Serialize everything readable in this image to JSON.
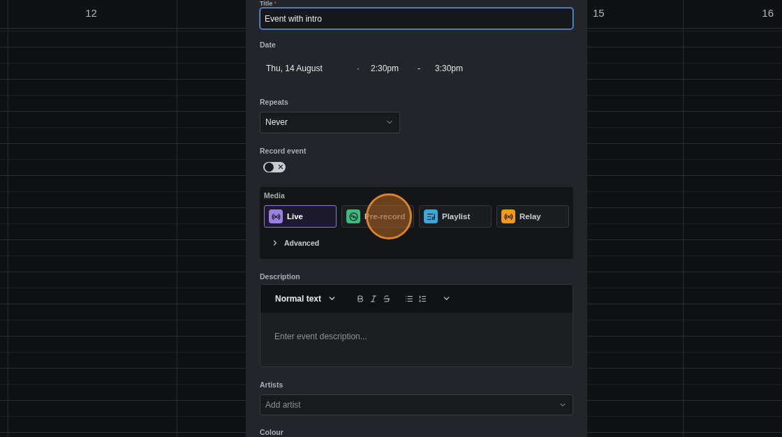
{
  "calendar": {
    "days": [
      {
        "label": "12"
      },
      {
        "label": "15"
      },
      {
        "label": "16"
      }
    ]
  },
  "form": {
    "title": {
      "label": "Title",
      "required_mark": "*",
      "value": "Event with intro",
      "focused": true
    },
    "date": {
      "label": "Date",
      "day": "Thu, 14 August",
      "separator": "·",
      "start": "2:30pm",
      "dash": "-",
      "end": "3:30pm"
    },
    "repeats": {
      "label": "Repeats",
      "value": "Never"
    },
    "record_event": {
      "label": "Record event",
      "on": false
    },
    "media": {
      "label": "Media",
      "options": [
        {
          "kind": "live",
          "label": "Live",
          "selected": true,
          "color": "#9b7fe2",
          "clicked": false
        },
        {
          "kind": "prerecord",
          "label": "Pre-record",
          "selected": false,
          "color": "#3dba7e",
          "clicked": true
        },
        {
          "kind": "playlist",
          "label": "Playlist",
          "selected": false,
          "color": "#3aa8dc",
          "clicked": false
        },
        {
          "kind": "relay",
          "label": "Relay",
          "selected": false,
          "color": "#f4991f",
          "clicked": false
        }
      ],
      "advanced": {
        "label": "Advanced",
        "expanded": false
      }
    },
    "description": {
      "label": "Description",
      "text_style": "Normal text",
      "placeholder": "Enter event description..."
    },
    "artists": {
      "label": "Artists",
      "placeholder": "Add artist"
    },
    "colour": {
      "label": "Colour"
    }
  }
}
